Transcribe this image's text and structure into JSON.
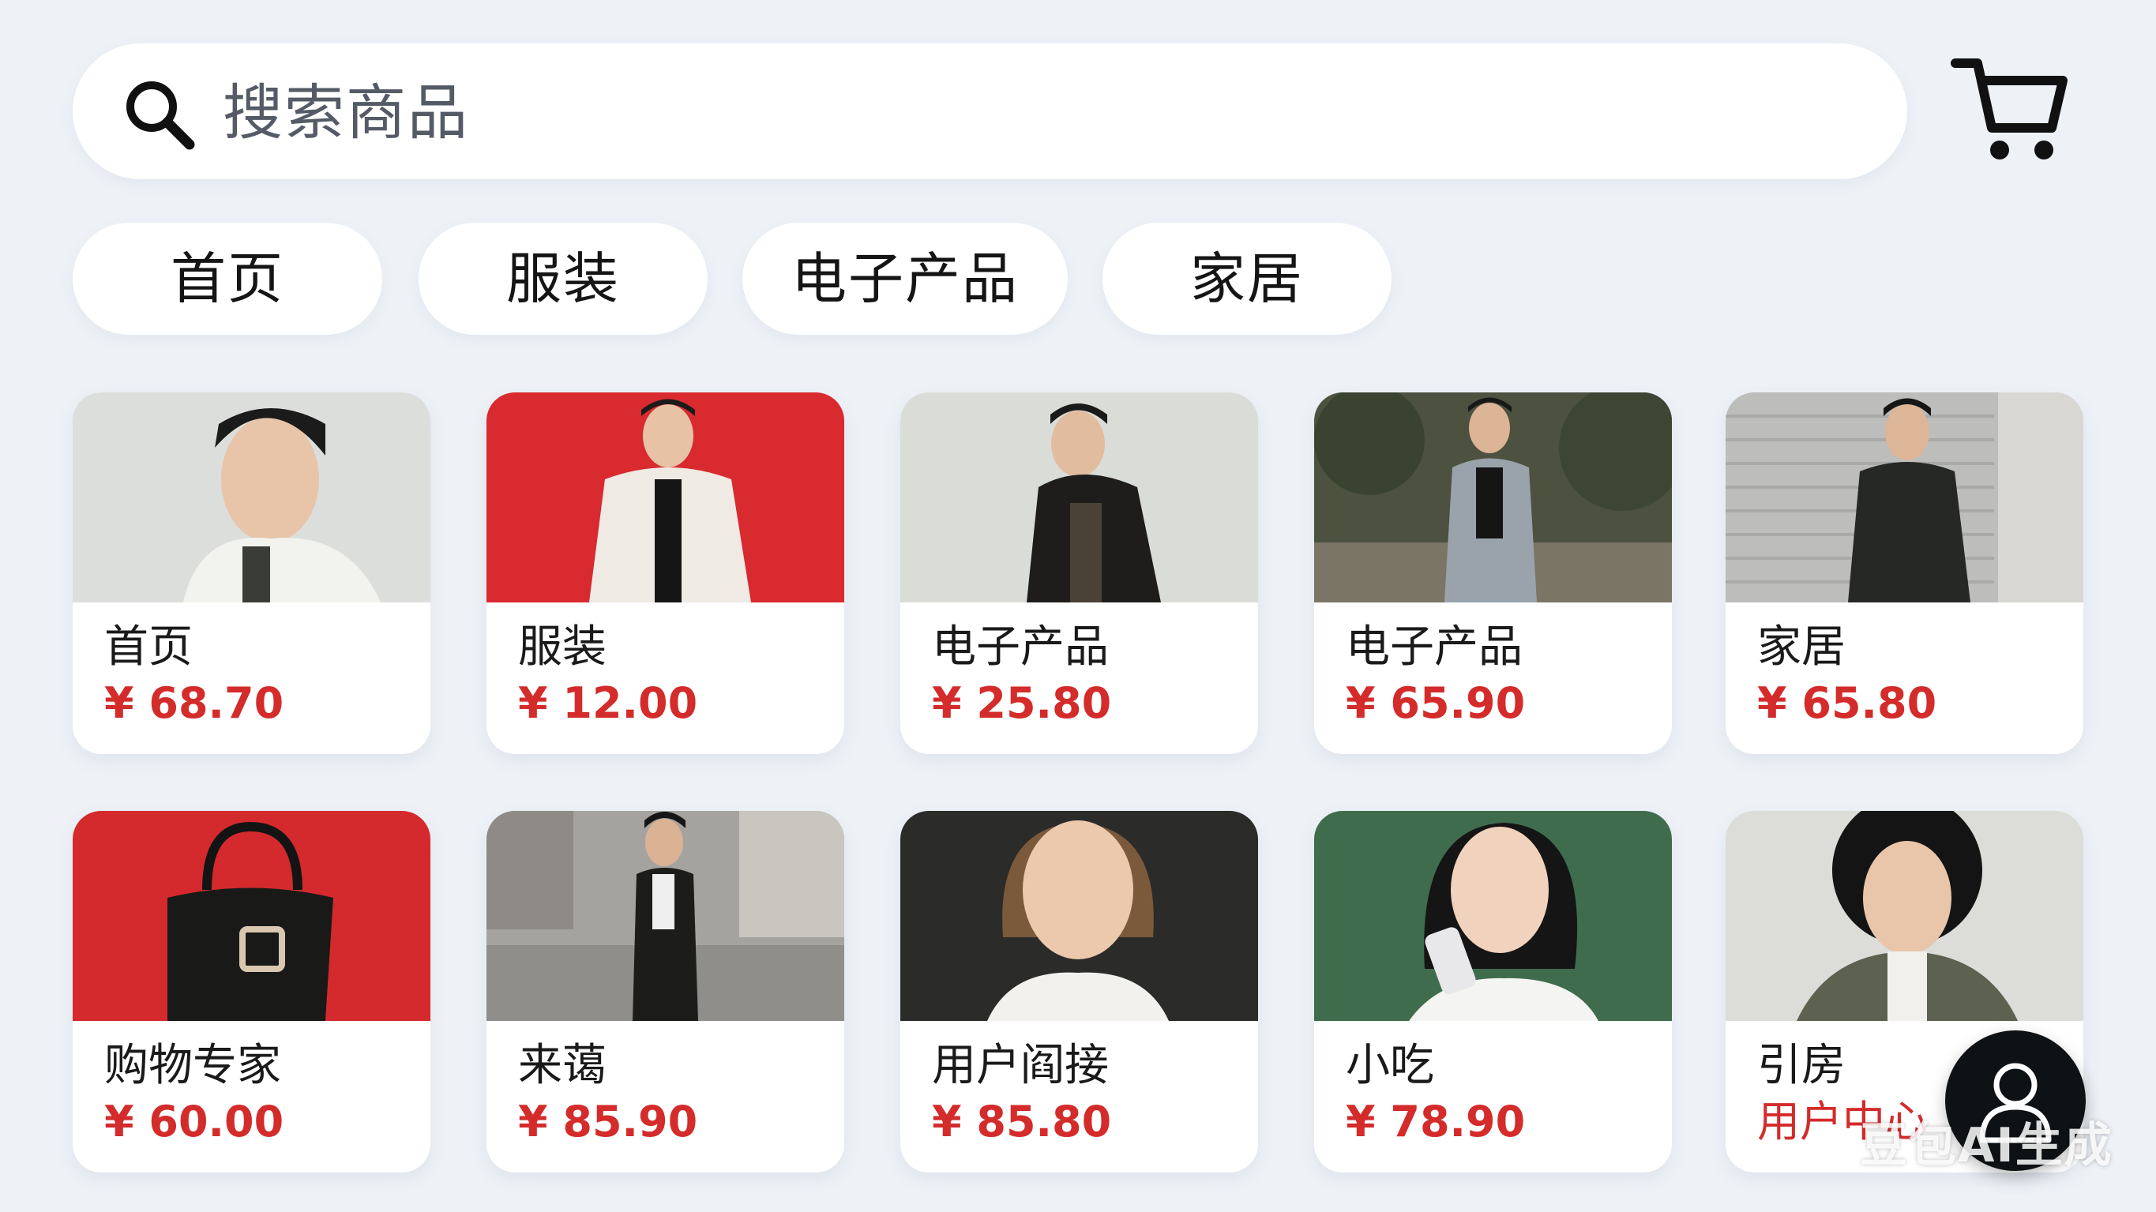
{
  "search": {
    "placeholder": "搜索商品"
  },
  "icons": {
    "search": "search-icon",
    "cart": "cart-icon",
    "user": "user-icon"
  },
  "tabs": [
    {
      "label": "首页"
    },
    {
      "label": "服装"
    },
    {
      "label": "电子产品"
    },
    {
      "label": "家居"
    }
  ],
  "products": [
    {
      "name": "首页",
      "price": "¥ 68.70",
      "photo_bg": "#d9dbd8"
    },
    {
      "name": "服装",
      "price": "¥ 12.00",
      "photo_bg": "#d82a2f"
    },
    {
      "name": "电子产品",
      "price": "¥ 25.80",
      "photo_bg": "#d8dad7"
    },
    {
      "name": "电子产品",
      "price": "¥ 65.90",
      "photo_bg": "#4a4f3e"
    },
    {
      "name": "家居",
      "price": "¥ 65.80",
      "photo_bg": "#b8b9b7"
    },
    {
      "name": "购物专家",
      "price": "¥ 60.00",
      "photo_bg": "#d42a2d"
    },
    {
      "name": "来蔼",
      "price": "¥ 85.90",
      "photo_bg": "#9a9895"
    },
    {
      "name": "用户阎接",
      "price": "¥ 85.80",
      "photo_bg": "#2a2a28"
    },
    {
      "name": "小吃",
      "price": "¥ 78.90",
      "photo_bg": "#3e6a4c"
    },
    {
      "name": "引房",
      "price": "用户中心",
      "photo_bg": "#dadad6"
    }
  ],
  "watermark": "豆包AI生成",
  "colors": {
    "accent": "#d42b2b",
    "background": "#eef2f7"
  }
}
